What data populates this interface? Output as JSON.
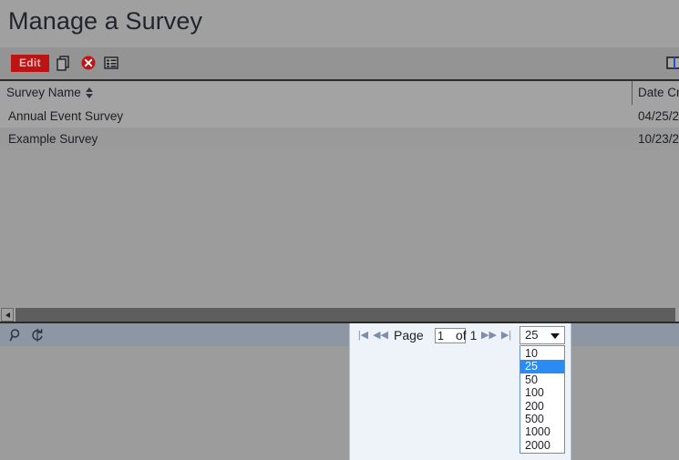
{
  "page": {
    "title": "Manage a Survey"
  },
  "toolbar": {
    "edit_label": "Edit",
    "icons": [
      {
        "name": "copy-icon",
        "title": "Copy"
      },
      {
        "name": "delete-icon",
        "title": "Delete"
      },
      {
        "name": "list-icon",
        "title": "List"
      },
      {
        "name": "columns-icon",
        "title": "Columns"
      }
    ]
  },
  "grid": {
    "columns": [
      {
        "key": "survey_name",
        "label": "Survey Name",
        "sortable": true
      },
      {
        "key": "date_created",
        "label": "Date Cr",
        "sortable": true
      }
    ],
    "rows": [
      {
        "survey_name": "Annual Event Survey",
        "date_created": "04/25/2"
      },
      {
        "survey_name": "Example Survey",
        "date_created": "10/23/2"
      }
    ]
  },
  "footer": {
    "icons": [
      {
        "name": "search-icon",
        "title": "Search"
      },
      {
        "name": "refresh-icon",
        "title": "Refresh"
      }
    ]
  },
  "pager": {
    "first_label": "|◀",
    "prev_label": "◀◀",
    "next_label": "▶▶",
    "last_label": "▶|",
    "page_label": "Page",
    "page_value": "1",
    "page_placeholder": "1",
    "of_label": "of 1",
    "page_size_selected": "25",
    "page_size_options": [
      "10",
      "25",
      "50",
      "100",
      "200",
      "500",
      "1000",
      "2000"
    ]
  },
  "colors": {
    "background": "#9c9c9c",
    "title_band": "#a0a0a0",
    "toolbar_band": "#949494",
    "edit_button": "#bd1313",
    "edit_button_text": "#e8b7b7",
    "header_row": "#a3a3a3",
    "row_even": "#a3a3a3",
    "row_odd": "#9a9a9a",
    "scrollbar_thumb": "#5e5e5e",
    "footer_band": "#8d97a4",
    "pager_panel": "#eef3fa",
    "dropdown_highlight": "#2a8bf2",
    "dropdown_border": "#5b8dd9"
  }
}
